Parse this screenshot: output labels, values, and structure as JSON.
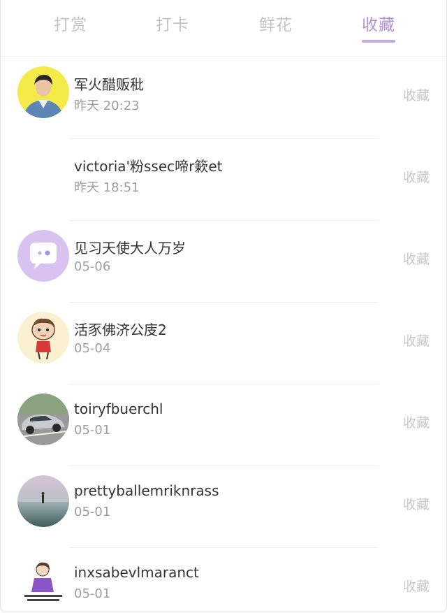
{
  "tabs": [
    {
      "label": "打赏",
      "active": false
    },
    {
      "label": "打卡",
      "active": false
    },
    {
      "label": "鲜花",
      "active": false
    },
    {
      "label": "收藏",
      "active": true
    }
  ],
  "accent_color": "#b68fd6",
  "items": [
    {
      "name": "军火醋贩秕",
      "date": "昨天 20:23",
      "action": "收藏",
      "avatar": "person-avatar"
    },
    {
      "name": "victoria'粉ssec啼r簌et",
      "date": "昨天 18:51",
      "action": "收藏",
      "avatar": "blank-avatar"
    },
    {
      "name": "见习天使大人万岁",
      "date": "05-06",
      "action": "收藏",
      "avatar": "chat-bubble-avatar"
    },
    {
      "name": "活豕佛济公庋2",
      "date": "05-04",
      "action": "收藏",
      "avatar": "cartoon-avatar"
    },
    {
      "name": "toiryfbuerchl",
      "date": "05-01",
      "action": "收藏",
      "avatar": "car-avatar"
    },
    {
      "name": "prettyballemriknrass",
      "date": "05-01",
      "action": "收藏",
      "avatar": "lake-avatar"
    },
    {
      "name": "inxsabevlmaranct",
      "date": "05-01",
      "action": "收藏",
      "avatar": "meme-avatar"
    }
  ]
}
